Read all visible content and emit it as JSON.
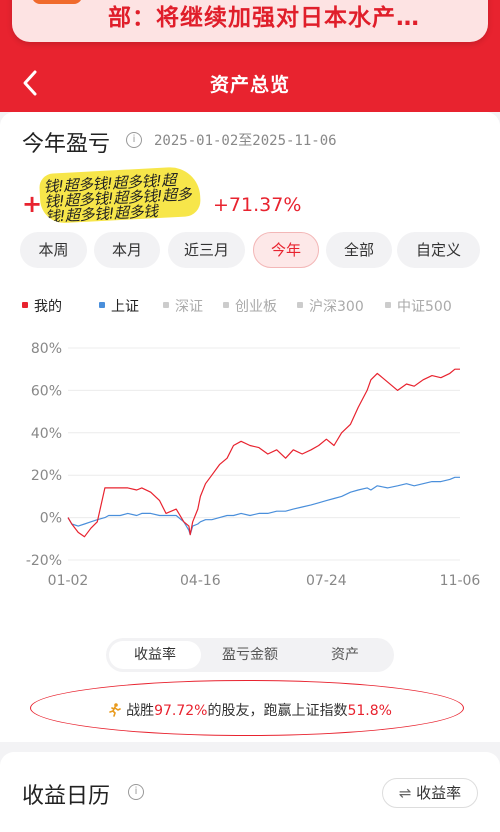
{
  "notice": {
    "text": "部：将继续加强对日本水产…"
  },
  "nav": {
    "title": "资产总览"
  },
  "pnl": {
    "title": "今年盈亏",
    "date_range": "2025-01-02至2025-11-06",
    "sticker_lines": [
      "钱!超多钱!超多钱!超",
      "钱!超多钱!超多钱!超多",
      "钱!超多钱!超多钱"
    ],
    "percent": "+71.37%"
  },
  "tabs": [
    {
      "label": "本周"
    },
    {
      "label": "本月"
    },
    {
      "label": "近三月"
    },
    {
      "label": "今年",
      "active": true
    },
    {
      "label": "全部"
    },
    {
      "label": "自定义"
    }
  ],
  "legend": [
    {
      "label": "我的",
      "color": "#e8232f",
      "active": true
    },
    {
      "label": "上证",
      "color": "#4a8fdb",
      "active": true
    },
    {
      "label": "深证",
      "color": "#cccccc",
      "active": false
    },
    {
      "label": "创业板",
      "color": "#cccccc",
      "active": false
    },
    {
      "label": "沪深300",
      "color": "#cccccc",
      "active": false
    },
    {
      "label": "中证500",
      "color": "#cccccc",
      "active": false
    }
  ],
  "chart_data": {
    "type": "line",
    "ylim": [
      -20,
      80
    ],
    "yticks": [
      "80%",
      "60%",
      "40%",
      "20%",
      "0%",
      "-20%"
    ],
    "xticks": [
      "01-02",
      "04-16",
      "07-24",
      "11-06"
    ],
    "grid": true,
    "series": [
      {
        "name": "我的",
        "color": "#e8232f",
        "x": [
          "01-02",
          "01-05",
          "01-10",
          "01-15",
          "01-20",
          "01-25",
          "01-31",
          "02-03",
          "02-08",
          "02-12",
          "02-18",
          "02-25",
          "03-01",
          "03-08",
          "03-15",
          "03-20",
          "03-28",
          "04-03",
          "04-07",
          "04-08",
          "04-10",
          "04-14",
          "04-16",
          "04-20",
          "04-25",
          "05-01",
          "05-07",
          "05-12",
          "05-18",
          "05-25",
          "06-01",
          "06-08",
          "06-15",
          "06-22",
          "06-28",
          "07-05",
          "07-12",
          "07-18",
          "07-24",
          "07-30",
          "08-05",
          "08-12",
          "08-18",
          "08-25",
          "08-28",
          "09-02",
          "09-10",
          "09-18",
          "09-25",
          "10-01",
          "10-08",
          "10-15",
          "10-22",
          "10-29",
          "11-02",
          "11-06"
        ],
        "values": [
          0,
          -3,
          -7,
          -9,
          -5,
          -2,
          14,
          14,
          14,
          14,
          14,
          13,
          14,
          12,
          8,
          2,
          4,
          -2,
          -4,
          -8,
          -2,
          4,
          10,
          16,
          20,
          25,
          28,
          34,
          36,
          34,
          33,
          30,
          32,
          28,
          32,
          30,
          32,
          34,
          37,
          34,
          40,
          44,
          52,
          60,
          65,
          68,
          64,
          60,
          63,
          62,
          65,
          67,
          66,
          68,
          70,
          70
        ]
      },
      {
        "name": "上证",
        "color": "#4a8fdb",
        "x": [
          "01-02",
          "01-05",
          "01-10",
          "01-15",
          "01-20",
          "01-25",
          "01-31",
          "02-03",
          "02-08",
          "02-12",
          "02-18",
          "02-25",
          "03-01",
          "03-08",
          "03-15",
          "03-20",
          "03-28",
          "04-03",
          "04-07",
          "04-08",
          "04-10",
          "04-14",
          "04-16",
          "04-20",
          "04-25",
          "05-01",
          "05-07",
          "05-12",
          "05-18",
          "05-25",
          "06-01",
          "06-08",
          "06-15",
          "06-22",
          "06-28",
          "07-05",
          "07-12",
          "07-18",
          "07-24",
          "07-30",
          "08-05",
          "08-12",
          "08-18",
          "08-25",
          "08-28",
          "09-02",
          "09-10",
          "09-18",
          "09-25",
          "10-01",
          "10-08",
          "10-15",
          "10-22",
          "10-29",
          "11-02",
          "11-06"
        ],
        "values": [
          0,
          -3,
          -4,
          -3,
          -2,
          -1,
          0,
          1,
          1,
          1,
          2,
          1,
          2,
          2,
          1,
          1,
          1,
          -2,
          -6,
          -8,
          -4,
          -3,
          -2,
          -1,
          -1,
          0,
          1,
          1,
          2,
          1,
          2,
          2,
          3,
          3,
          4,
          5,
          6,
          7,
          8,
          9,
          10,
          12,
          13,
          14,
          13,
          15,
          14,
          15,
          16,
          15,
          16,
          17,
          17,
          18,
          19,
          19
        ]
      }
    ]
  },
  "segment": [
    {
      "label": "收益率",
      "active": true
    },
    {
      "label": "盈亏金额"
    },
    {
      "label": "资产"
    }
  ],
  "beat": {
    "prefix": "战胜",
    "pct1": "97.72%",
    "mid": "的股友，跑赢上证指数",
    "pct2": "51.8%"
  },
  "calendar": {
    "title": "收益日历",
    "button_label": "收益率"
  }
}
